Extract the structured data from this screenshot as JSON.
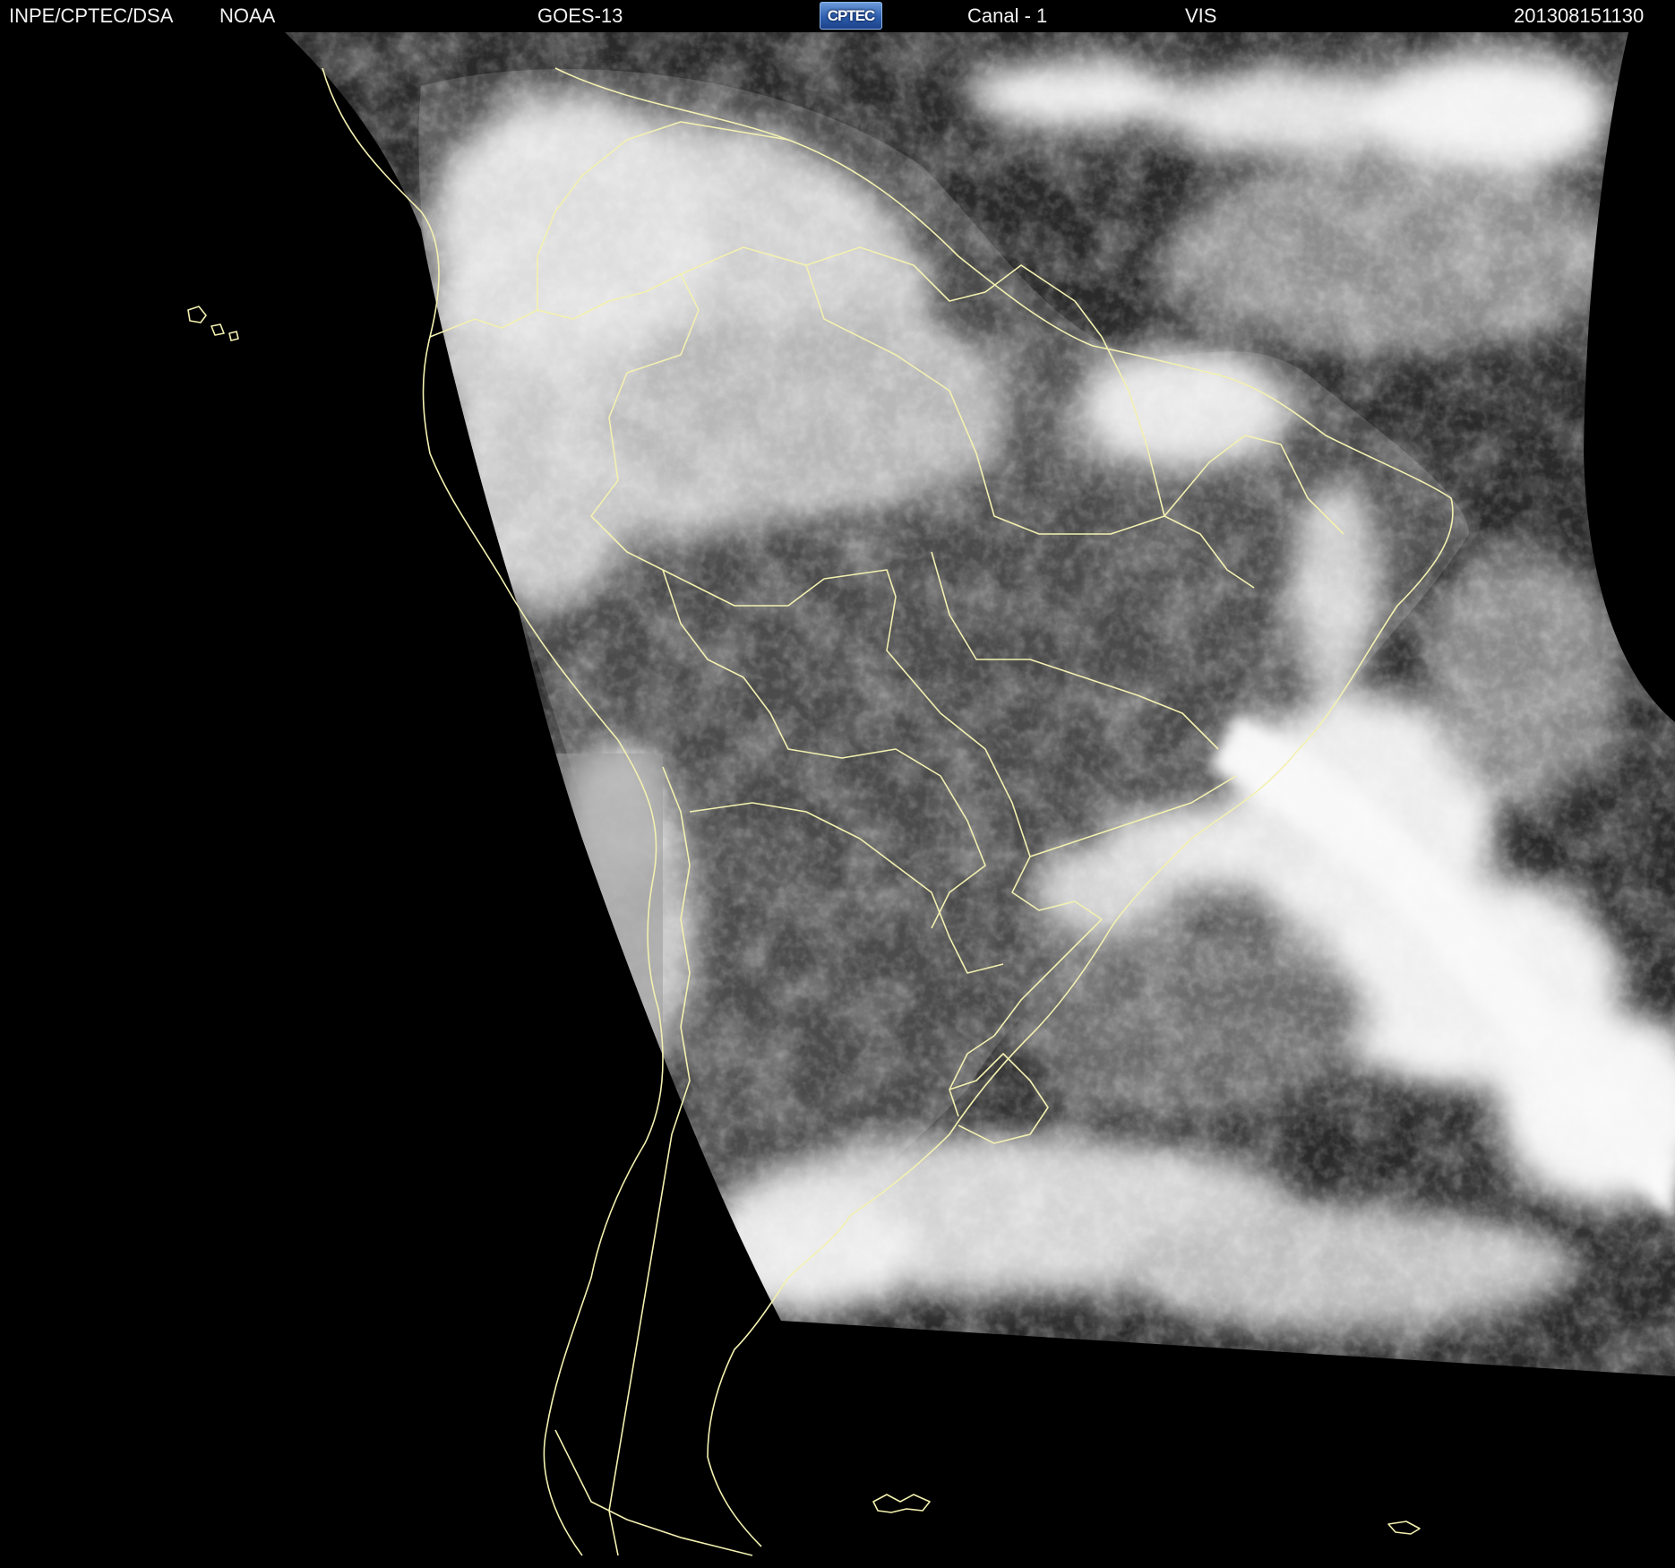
{
  "header": {
    "institution": "INPE/CPTEC/DSA",
    "agency": "NOAA",
    "satellite": "GOES-13",
    "logo_text": "CPTEC",
    "channel": "Canal - 1",
    "band": "VIS",
    "timestamp": "201308151130"
  },
  "colors": {
    "background": "#000000",
    "header_text": "#f2f2f2",
    "borders": "#f3f1b0",
    "cloud_bright": "#f4f4f4",
    "land_dark": "#4a4a4a",
    "ocean": "#232323"
  },
  "map": {
    "projection": "satellite",
    "image_type": "visible grayscale"
  }
}
